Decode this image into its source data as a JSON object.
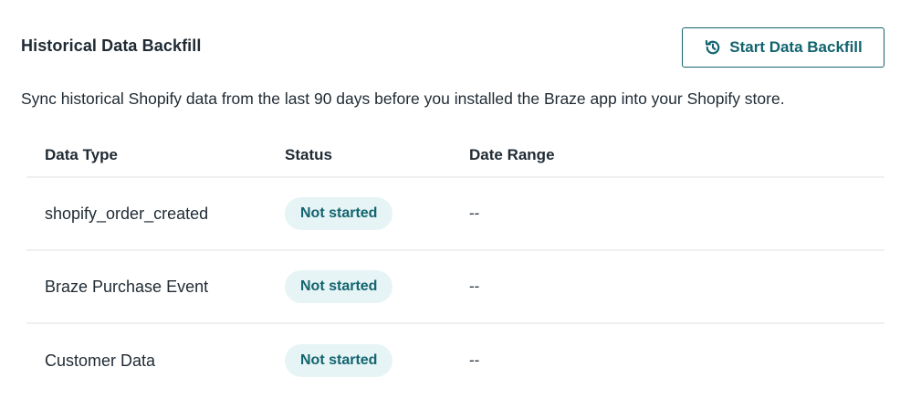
{
  "section": {
    "title": "Historical Data Backfill",
    "start_button_label": "Start Data Backfill",
    "start_button_icon": "history-icon",
    "accent_color": "#12646f",
    "description": "Sync historical Shopify data from the last 90 days before you installed the Braze app into your Shopify store."
  },
  "table": {
    "columns": {
      "data_type": "Data Type",
      "status": "Status",
      "date_range": "Date Range"
    },
    "rows": [
      {
        "data_type": "shopify_order_created",
        "status": "Not started",
        "date_range": "--"
      },
      {
        "data_type": "Braze Purchase Event",
        "status": "Not started",
        "date_range": "--"
      },
      {
        "data_type": "Customer Data",
        "status": "Not started",
        "date_range": "--"
      }
    ]
  }
}
